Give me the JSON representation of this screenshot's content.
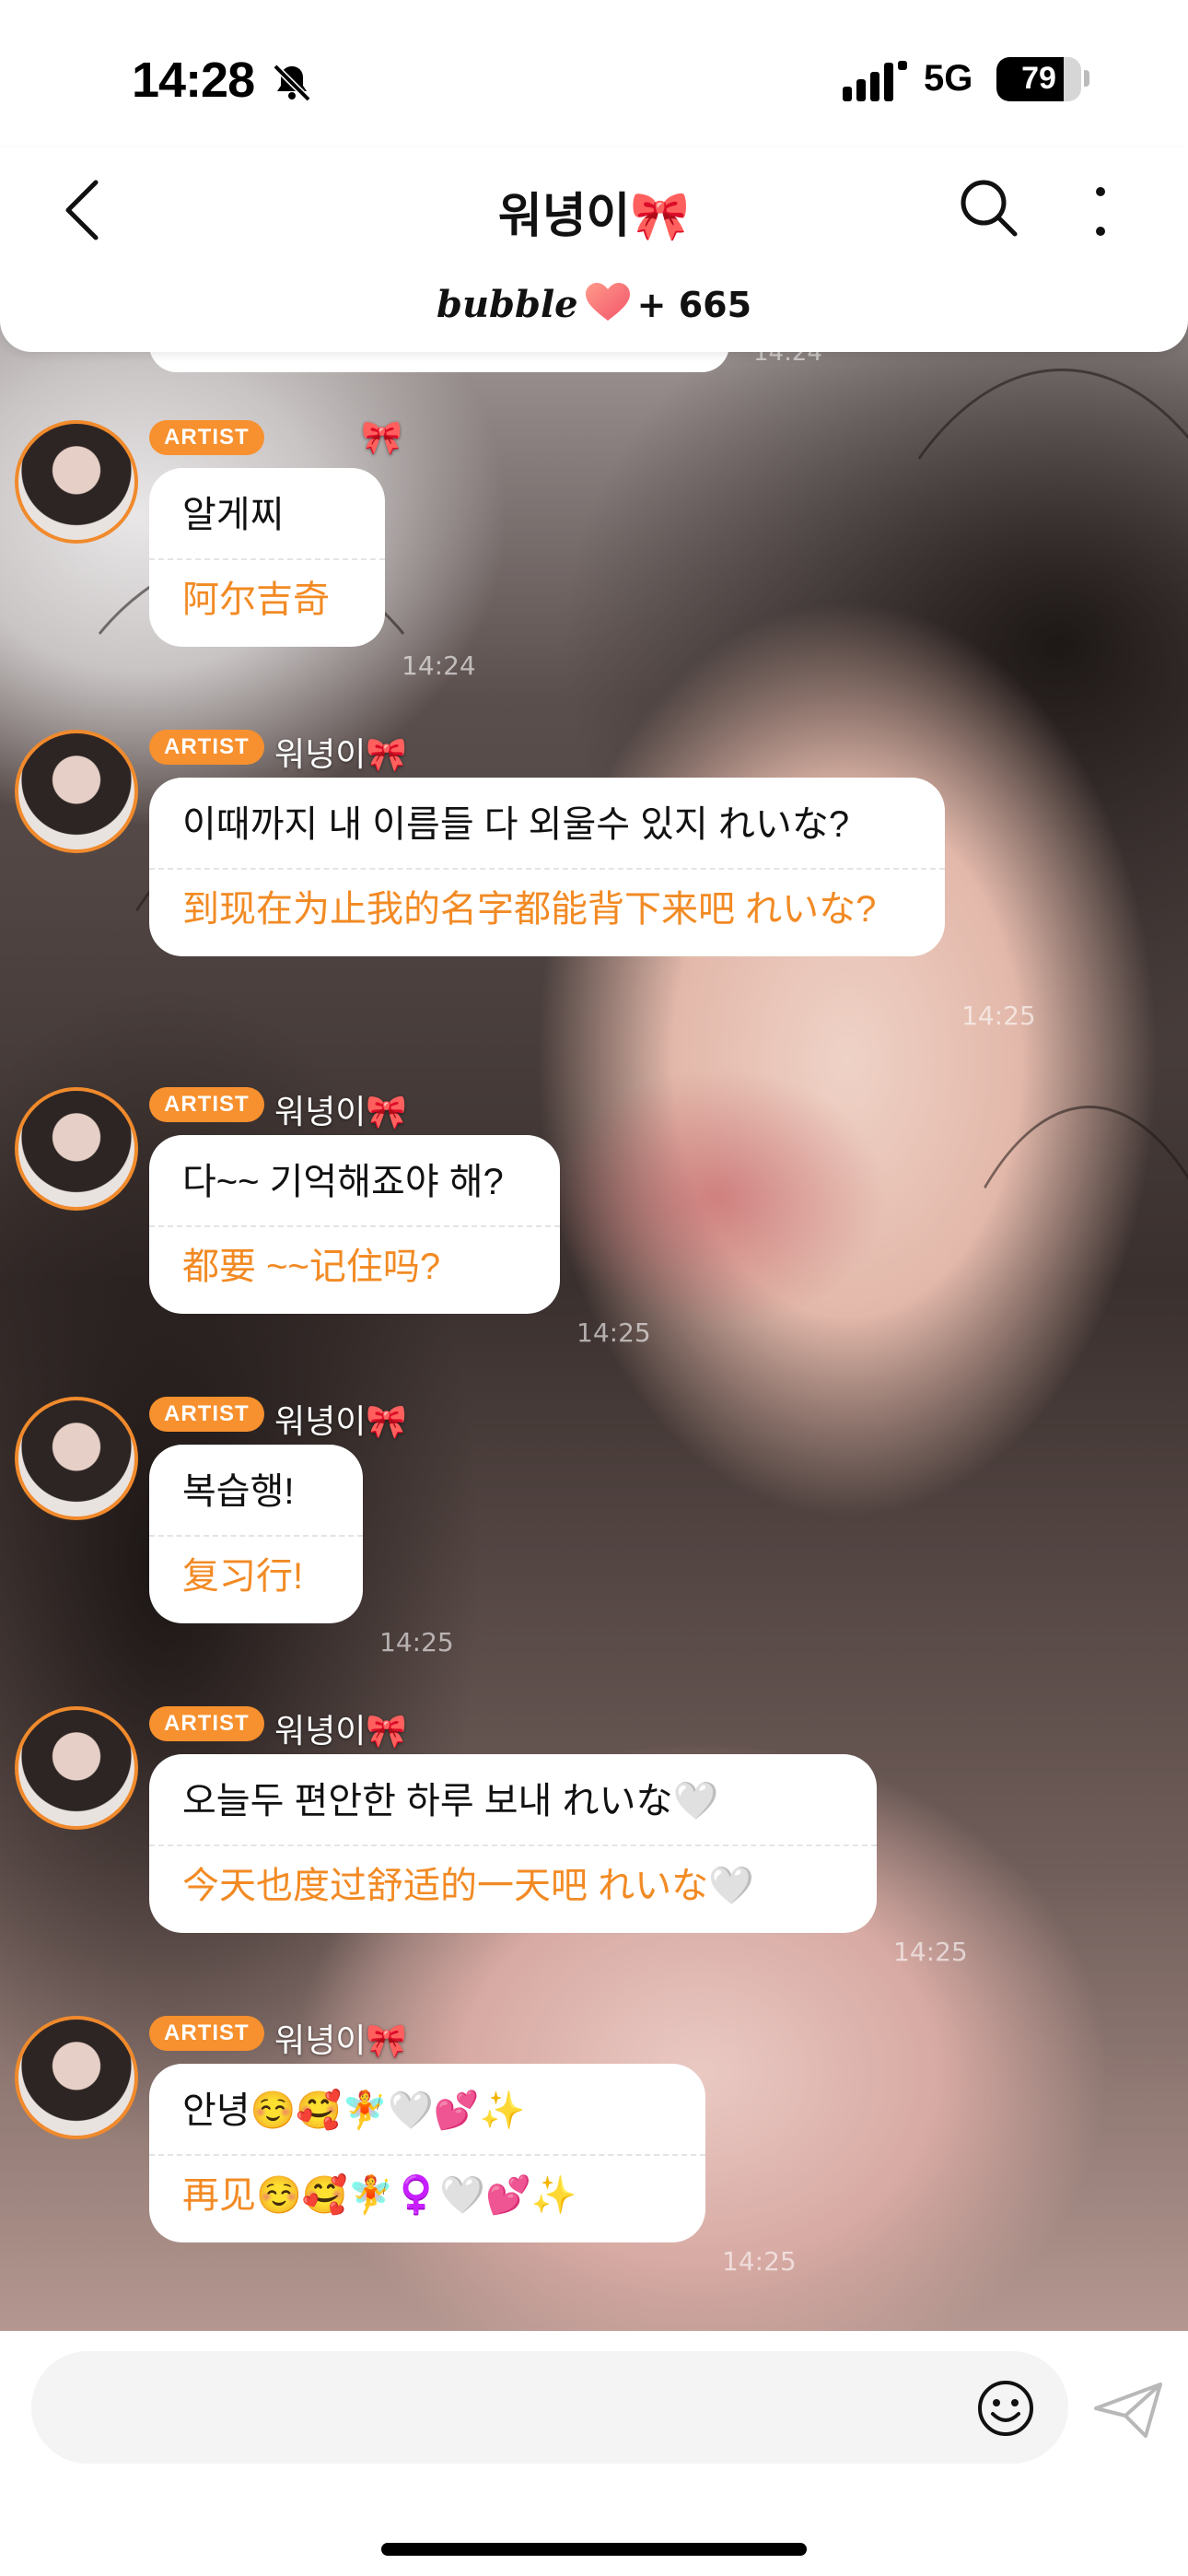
{
  "status_bar": {
    "time": "14:28",
    "network": "5G",
    "battery": "79",
    "battery_level": 0.79
  },
  "header": {
    "title": "워녕이🎀",
    "brand": "bubble",
    "reaction_count": "+ 665"
  },
  "messages": [
    {
      "badge": "ARTIST",
      "sender": "🎀",
      "text_ko": "알게찌",
      "text_zh": "阿尔吉奇",
      "time": "14:24"
    },
    {
      "badge": "ARTIST",
      "sender": "워녕이🎀",
      "text_ko": "이때까지 내 이름들 다 외울수 있지 れいな?",
      "text_zh": "到现在为止我的名字都能背下来吧 れいな?",
      "time": "14:25"
    },
    {
      "badge": "ARTIST",
      "sender": "워녕이🎀",
      "text_ko": "다~~ 기억해죠야 해?",
      "text_zh": "都要 ~~记住吗?",
      "time": "14:25"
    },
    {
      "badge": "ARTIST",
      "sender": "워녕이🎀",
      "text_ko": "복습행!",
      "text_zh": "复习行!",
      "time": "14:25"
    },
    {
      "badge": "ARTIST",
      "sender": "워녕이🎀",
      "text_ko": "오늘두 편안한 하루 보내 れいな🤍",
      "text_zh": "今天也度过舒适的一天吧 れいな🤍",
      "time": "14:25"
    },
    {
      "badge": "ARTIST",
      "sender": "워녕이🎀",
      "text_ko": "안녕☺️🥰🧚🤍💕✨",
      "text_zh": "再见☺️🥰🧚♀️🤍💕✨",
      "time": "14:25"
    }
  ],
  "partial_time": "14:24",
  "input": {
    "placeholder": ""
  },
  "colors": {
    "accent": "#f7902e",
    "translation": "#f28a24"
  }
}
